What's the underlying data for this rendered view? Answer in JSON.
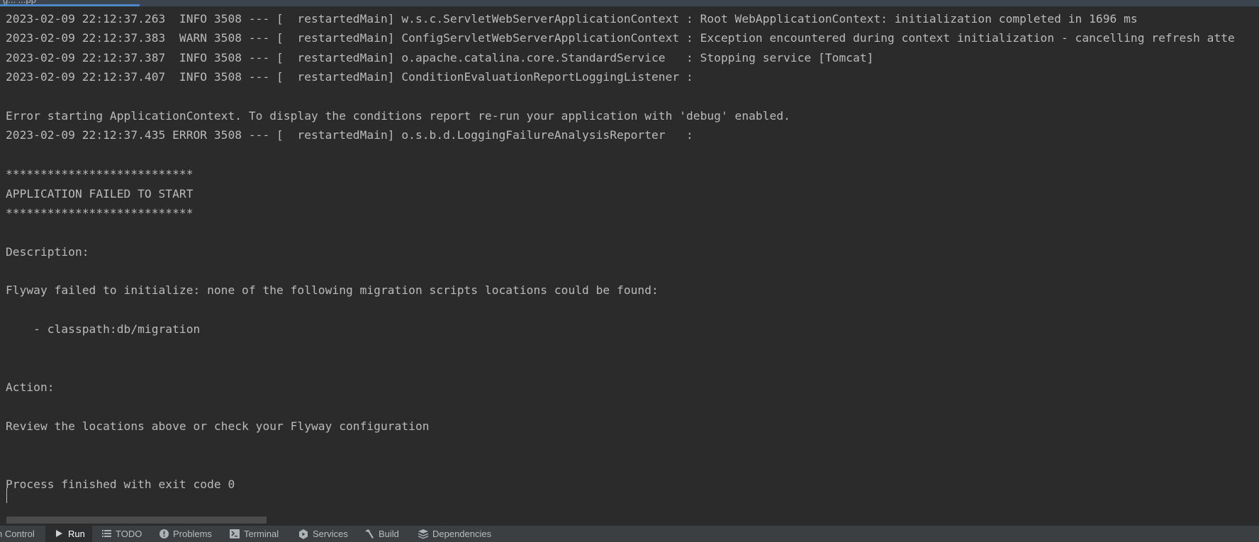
{
  "window": {
    "top_tab_label": "g...  ...pp"
  },
  "console": {
    "lines": [
      "2023-02-09 22:12:37.263  INFO 3508 --- [  restartedMain] w.s.c.ServletWebServerApplicationContext : Root WebApplicationContext: initialization completed in 1696 ms",
      "2023-02-09 22:12:37.383  WARN 3508 --- [  restartedMain] ConfigServletWebServerApplicationContext : Exception encountered during context initialization - cancelling refresh atte",
      "2023-02-09 22:12:37.387  INFO 3508 --- [  restartedMain] o.apache.catalina.core.StandardService   : Stopping service [Tomcat]",
      "2023-02-09 22:12:37.407  INFO 3508 --- [  restartedMain] ConditionEvaluationReportLoggingListener : ",
      "",
      "Error starting ApplicationContext. To display the conditions report re-run your application with 'debug' enabled.",
      "2023-02-09 22:12:37.435 ERROR 3508 --- [  restartedMain] o.s.b.d.LoggingFailureAnalysisReporter   : ",
      "",
      "***************************",
      "APPLICATION FAILED TO START",
      "***************************",
      "",
      "Description:",
      "",
      "Flyway failed to initialize: none of the following migration scripts locations could be found:",
      "",
      "    - classpath:db/migration",
      "",
      "",
      "Action:",
      "",
      "Review the locations above or check your Flyway configuration",
      "",
      "",
      "Process finished with exit code 0"
    ]
  },
  "bottom_bar": {
    "tabs": [
      {
        "label": "n Control",
        "icon": "version-control-icon",
        "active": false
      },
      {
        "label": "Run",
        "icon": "play-icon",
        "active": true
      },
      {
        "label": "TODO",
        "icon": "list-icon",
        "active": false
      },
      {
        "label": "Problems",
        "icon": "exclamation-circle-icon",
        "active": false
      },
      {
        "label": "Terminal",
        "icon": "terminal-icon",
        "active": false
      },
      {
        "label": "Services",
        "icon": "services-icon",
        "active": false
      },
      {
        "label": "Build",
        "icon": "hammer-icon",
        "active": false
      },
      {
        "label": "Dependencies",
        "icon": "layers-icon",
        "active": false
      }
    ]
  },
  "colors": {
    "console_bg": "#2b2b2b",
    "console_text": "#bbbbbb",
    "toolbar_bg": "#3c3f41",
    "accent": "#4a88c7"
  }
}
